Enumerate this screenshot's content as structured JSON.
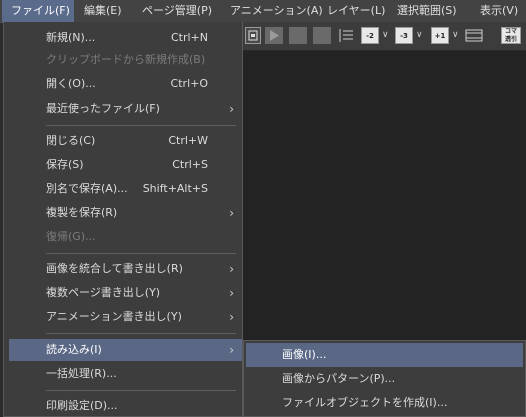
{
  "menubar": {
    "items": [
      {
        "label": "ファイル(F)"
      },
      {
        "label": "編集(E)"
      },
      {
        "label": "ページ管理(P)"
      },
      {
        "label": "アニメーション(A)"
      },
      {
        "label": "レイヤー(L)"
      },
      {
        "label": "選択範囲(S)"
      },
      {
        "label": "表示(V)"
      }
    ]
  },
  "toolbar": {
    "icons": [
      "thumbnail-icon",
      "play-icon",
      "stop-icon",
      "frame-icon",
      "frame2-icon",
      "layer-order-icon",
      "step-back-2-icon",
      "step-back-3-icon",
      "add-1-icon",
      "film-icon",
      "onion-skin-icon"
    ],
    "labels": {
      "back2": "-2",
      "back3": "-3",
      "plus1": "+1",
      "onion_top": "コマ",
      "onion_bottom": "透引"
    }
  },
  "file_menu": {
    "items": [
      {
        "label": "新規(N)...",
        "shortcut": "Ctrl+N"
      },
      {
        "label": "クリップボードから新規作成(B)",
        "shortcut": ""
      },
      {
        "label": "開く(O)...",
        "shortcut": "Ctrl+O"
      },
      {
        "label": "最近使ったファイル(F)",
        "shortcut": ""
      },
      {
        "label": "閉じる(C)",
        "shortcut": "Ctrl+W"
      },
      {
        "label": "保存(S)",
        "shortcut": "Ctrl+S"
      },
      {
        "label": "別名で保存(A)...",
        "shortcut": "Shift+Alt+S"
      },
      {
        "label": "複製を保存(R)",
        "shortcut": ""
      },
      {
        "label": "復帰(G)...",
        "shortcut": ""
      },
      {
        "label": "画像を統合して書き出し(R)",
        "shortcut": ""
      },
      {
        "label": "複数ページ書き出し(Y)",
        "shortcut": ""
      },
      {
        "label": "アニメーション書き出し(Y)",
        "shortcut": ""
      },
      {
        "label": "読み込み(I)",
        "shortcut": ""
      },
      {
        "label": "一括処理(R)...",
        "shortcut": ""
      },
      {
        "label": "印刷設定(D)...",
        "shortcut": ""
      }
    ]
  },
  "import_submenu": {
    "items": [
      {
        "label": "画像(I)..."
      },
      {
        "label": "画像からパターン(P)..."
      },
      {
        "label": "ファイルオブジェクトを作成(I)..."
      }
    ]
  },
  "colors": {
    "highlight": "#5a6785",
    "menubar_active": "#5b6b8c",
    "menu_bg": "#3d3d3d"
  }
}
